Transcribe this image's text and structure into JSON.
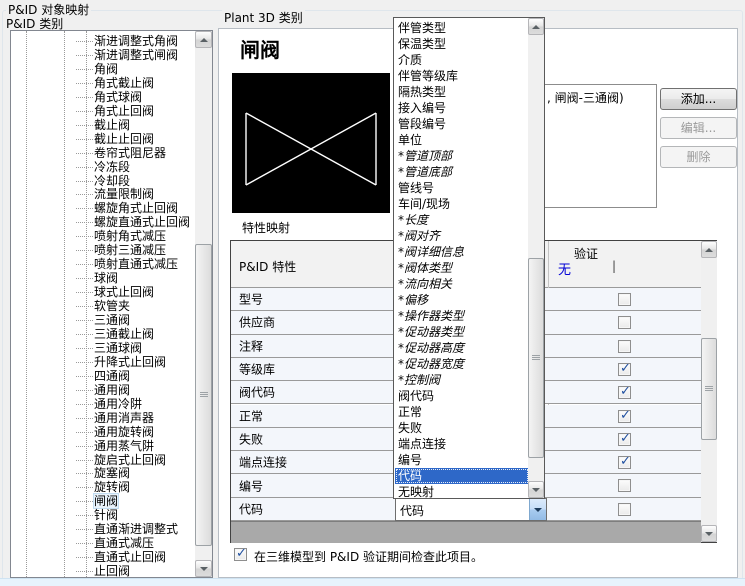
{
  "labels": {
    "pid_object_mapping": "P&ID 对象映射",
    "pid_category": "P&ID 类别",
    "plant3d_category": "Plant 3D 类别",
    "property_mapping": "特性映射",
    "detail_title": "闸阀"
  },
  "colors": {
    "highlight_blue": "#2e68c8",
    "link_blue": "#0000d4",
    "preview_bg": "#000000",
    "preview_symbol": "#ffffff",
    "table_row_bg": "#f3f6fb",
    "gray_filler": "#a9a9a9"
  },
  "tree": {
    "selected_index": 33,
    "items": [
      "渐进调整式角阀",
      "渐进调整式闸阀",
      "角阀",
      "角式截止阀",
      "角式球阀",
      "角式止回阀",
      "截止阀",
      "截止止回阀",
      "卷帘式阻尼器",
      "冷冻段",
      "冷却段",
      "流量限制阀",
      "螺旋角式止回阀",
      "螺旋直通式止回阀",
      "喷射角式减压",
      "喷射三通减压",
      "喷射直通式减压",
      "球阀",
      "球式止回阀",
      "软管夹",
      "三通阀",
      "三通截止阀",
      "三通球阀",
      "升降式止回阀",
      "四通阀",
      "通用阀",
      "通用冷阱",
      "通用消声器",
      "通用旋转阀",
      "通用蒸气阱",
      "旋启式止回阀",
      "旋塞阀",
      "旋转阀",
      "闸阀",
      "针阀",
      "直通渐进调整式",
      "直通式减压",
      "直通式止回阀",
      "止回阀"
    ]
  },
  "mapping_list": {
    "visible_item_text": ", 闸阀-三通阀)"
  },
  "buttons": {
    "add": "添加...",
    "edit": "编辑...",
    "delete": "删除"
  },
  "table": {
    "pid_header": "P&ID 特性",
    "validate_header": "验证",
    "link_none": "无",
    "link_separator": "|",
    "rows": [
      {
        "label": "型号",
        "checked": false
      },
      {
        "label": "供应商",
        "checked": false
      },
      {
        "label": "注释",
        "checked": false
      },
      {
        "label": "等级库",
        "checked": true
      },
      {
        "label": "阀代码",
        "checked": true
      },
      {
        "label": "正常",
        "checked": true
      },
      {
        "label": "失败",
        "checked": true
      },
      {
        "label": "端点连接",
        "checked": true
      },
      {
        "label": "编号",
        "checked": false
      },
      {
        "label": "代码",
        "checked": false
      }
    ]
  },
  "combobox": {
    "value": "代码"
  },
  "dropdown": {
    "selected_index": 28,
    "items": [
      {
        "label": "伴管类型",
        "italic": false
      },
      {
        "label": "保温类型",
        "italic": false
      },
      {
        "label": "介质",
        "italic": false
      },
      {
        "label": "伴管等级库",
        "italic": false
      },
      {
        "label": "隔热类型",
        "italic": false
      },
      {
        "label": "接入编号",
        "italic": false
      },
      {
        "label": "管段编号",
        "italic": false
      },
      {
        "label": "单位",
        "italic": false
      },
      {
        "label": "*管道顶部",
        "italic": true
      },
      {
        "label": "*管道底部",
        "italic": true
      },
      {
        "label": "管线号",
        "italic": false
      },
      {
        "label": "车间/现场",
        "italic": false
      },
      {
        "label": "*长度",
        "italic": true
      },
      {
        "label": "*阀对齐",
        "italic": true
      },
      {
        "label": "*阀详细信息",
        "italic": true
      },
      {
        "label": "*阀体类型",
        "italic": true
      },
      {
        "label": "*流向相关",
        "italic": true
      },
      {
        "label": "*偏移",
        "italic": true
      },
      {
        "label": "*操作器类型",
        "italic": true
      },
      {
        "label": "*促动器类型",
        "italic": true
      },
      {
        "label": "*促动器高度",
        "italic": true
      },
      {
        "label": "*促动器宽度",
        "italic": true
      },
      {
        "label": "*控制阀",
        "italic": true
      },
      {
        "label": "阀代码",
        "italic": false
      },
      {
        "label": "正常",
        "italic": false
      },
      {
        "label": "失败",
        "italic": false
      },
      {
        "label": "端点连接",
        "italic": false
      },
      {
        "label": "编号",
        "italic": false
      },
      {
        "label": "代码",
        "italic": false
      },
      {
        "label": "无映射",
        "italic": false
      }
    ]
  },
  "footer": {
    "checkbox_label": "在三维模型到 P&ID 验证期间检查此项目。",
    "checked": true
  }
}
